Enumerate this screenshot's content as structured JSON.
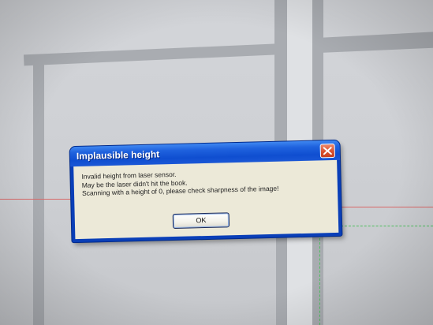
{
  "dialog": {
    "title": "Implausible height",
    "message_lines": [
      "Invalid height from laser sensor.",
      "May be the laser didn't hit the book.",
      "Scanning with a height of 0, please check sharpness of the image!"
    ],
    "ok_label": "OK"
  },
  "icons": {
    "close": "close-icon"
  },
  "colors": {
    "titlebar": "#1f62de",
    "close_button": "#d9502d",
    "dialog_body": "#ece9d8",
    "laser_line": "#d86868",
    "guide_line": "#4fbf5f"
  }
}
